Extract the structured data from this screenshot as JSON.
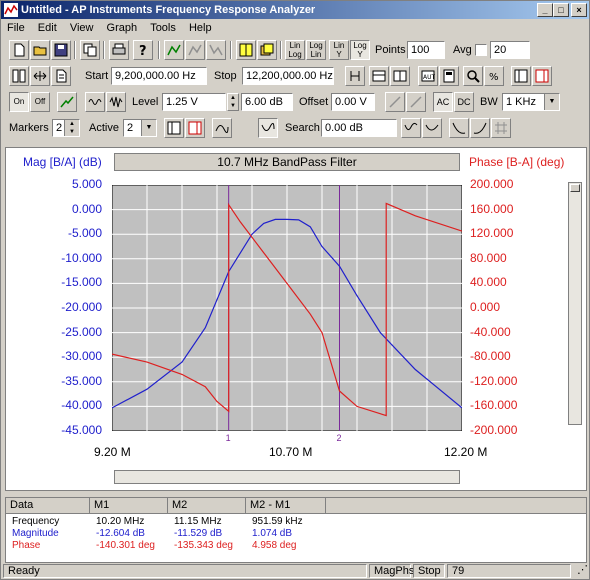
{
  "window": {
    "title": "Untitled - AP Instruments Frequency Response Analyzer"
  },
  "menu": [
    "File",
    "Edit",
    "View",
    "Graph",
    "Tools",
    "Help"
  ],
  "toolbar1": {
    "lin_label": "Lin",
    "log_label": "Log",
    "points_label": "Points",
    "points_value": "100",
    "avg_label": "Avg",
    "avg_value": "20"
  },
  "toolbar2": {
    "start_label": "Start",
    "start_value": "9,200,000.00 Hz",
    "stop_label": "Stop",
    "stop_value": "12,200,000.00 Hz"
  },
  "toolbar3": {
    "on_label": "On",
    "off_label": "Off",
    "level_label": "Level",
    "level_value": "1.25 V",
    "level_db_value": "6.00 dB",
    "offset_label": "Offset",
    "offset_value": "0.00 V",
    "ac_label": "AC",
    "dc_label": "DC",
    "bw_label": "BW",
    "bw_value": "1 KHz"
  },
  "toolbar4": {
    "markers_label": "Markers",
    "markers_value": "2",
    "active_label": "Active",
    "active_value": "2",
    "search_label": "Search",
    "search_value": "0.00 dB"
  },
  "chart_data": {
    "type": "line",
    "title": "10.7 MHz BandPass Filter",
    "ylabel_left": "Mag [B/A] (dB)",
    "ylabel_right": "Phase [B-A] (deg)",
    "x_ticks": [
      "9.20 M",
      "10.70 M",
      "12.20 M"
    ],
    "xlim": [
      9.2,
      12.2
    ],
    "ylim_left": [
      -45,
      5
    ],
    "ylim_right": [
      -200,
      200
    ],
    "left_ticks": [
      "5.000",
      "0.000",
      "-5.000",
      "-10.000",
      "-15.000",
      "-20.000",
      "-25.000",
      "-30.000",
      "-35.000",
      "-40.000",
      "-45.000"
    ],
    "right_ticks": [
      "200.000",
      "160.000",
      "120.000",
      "80.000",
      "40.000",
      "0.000",
      "-40.000",
      "-80.000",
      "-120.000",
      "-160.000",
      "-200.000"
    ],
    "grid": true,
    "colors": {
      "magnitude": "#2020cc",
      "phase": "#dd2020",
      "marker": "#7a2a9a",
      "plot_bg": "#c0c0c0",
      "grid": "#ffffff"
    },
    "series": [
      {
        "name": "Magnitude",
        "axis": "left",
        "x": [
          9.2,
          9.5,
          9.8,
          10.0,
          10.2,
          10.4,
          10.5,
          10.6,
          10.7,
          10.8,
          10.9,
          11.0,
          11.15,
          11.3,
          11.5,
          11.8,
          12.2
        ],
        "y": [
          -40.3,
          -36.5,
          -31.0,
          -24.0,
          -12.6,
          -5.0,
          -2.8,
          -2.0,
          -2.0,
          -2.1,
          -3.5,
          -7.5,
          -11.5,
          -17.5,
          -25.0,
          -32.5,
          -40.3
        ]
      },
      {
        "name": "Phase",
        "axis": "right",
        "x": [
          9.2,
          9.5,
          9.8,
          10.0,
          10.1,
          10.2,
          10.2001,
          10.3,
          10.5,
          10.7,
          10.9,
          11.0,
          11.15,
          11.3,
          11.55,
          11.5501,
          11.8,
          12.2
        ],
        "y": [
          -75,
          -88,
          -108,
          -128,
          -152,
          -168,
          168,
          140,
          90,
          40,
          -10,
          -40,
          -135,
          -160,
          -175,
          170,
          150,
          125
        ]
      }
    ],
    "markers": [
      {
        "label": "1",
        "x": 10.2
      },
      {
        "label": "2",
        "x": 11.15
      }
    ]
  },
  "results_table": {
    "headers": [
      "Data",
      "M1",
      "M2",
      "M2 - M1"
    ],
    "rows": [
      {
        "name": "Frequency",
        "m1": "10.20 MHz",
        "m2": "11.15 MHz",
        "diff": "951.59 kHz",
        "color": "#000000"
      },
      {
        "name": "Magnitude",
        "m1": "-12.604 dB",
        "m2": "-11.529 dB",
        "diff": "1.074 dB",
        "color": "#2020cc"
      },
      {
        "name": "Phase",
        "m1": "-140.301 deg",
        "m2": "-135.343 deg",
        "diff": "4.958 deg",
        "color": "#dd2020"
      }
    ]
  },
  "status": {
    "ready": "Ready",
    "mode": "MagPhs",
    "state": "Stop",
    "count": "79"
  }
}
